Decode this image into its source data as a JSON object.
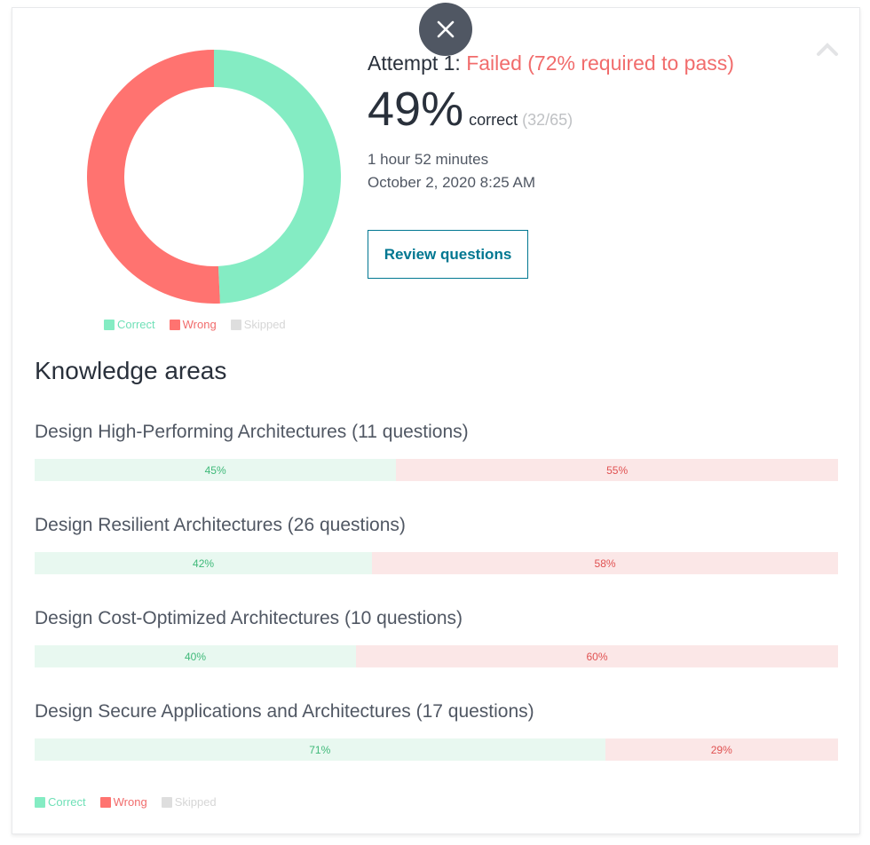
{
  "attempt": {
    "prefix": "Attempt 1: ",
    "status": "Failed (72% required to pass)",
    "percent": "49%",
    "correct_label": "correct",
    "count": "(32/65)",
    "duration": "1 hour 52 minutes",
    "date": "October 2, 2020 8:25 AM"
  },
  "review_button": "Review questions",
  "donut": {
    "correct_fraction": 0.4923,
    "wrong_fraction": 0.5077,
    "skipped_fraction": 0
  },
  "legend": {
    "correct": "Correct",
    "wrong": "Wrong",
    "skipped": "Skipped"
  },
  "colors": {
    "correct": "#84ecc3",
    "wrong": "#ff7370",
    "skipped": "#dedede",
    "accent": "#007791"
  },
  "icons": {
    "close": "close-icon",
    "collapse": "chevron-up-icon"
  },
  "knowledge_title": "Knowledge areas",
  "areas": [
    {
      "name": "Design High-Performing Architectures (11 questions)",
      "correct": 45,
      "wrong": 55,
      "correct_label": "45%",
      "wrong_label": "55%"
    },
    {
      "name": "Design Resilient Architectures (26 questions)",
      "correct": 42,
      "wrong": 58,
      "correct_label": "42%",
      "wrong_label": "58%"
    },
    {
      "name": "Design Cost-Optimized Architectures (10 questions)",
      "correct": 40,
      "wrong": 60,
      "correct_label": "40%",
      "wrong_label": "60%"
    },
    {
      "name": "Design Secure Applications and Architectures (17 questions)",
      "correct": 71,
      "wrong": 29,
      "correct_label": "71%",
      "wrong_label": "29%"
    }
  ]
}
